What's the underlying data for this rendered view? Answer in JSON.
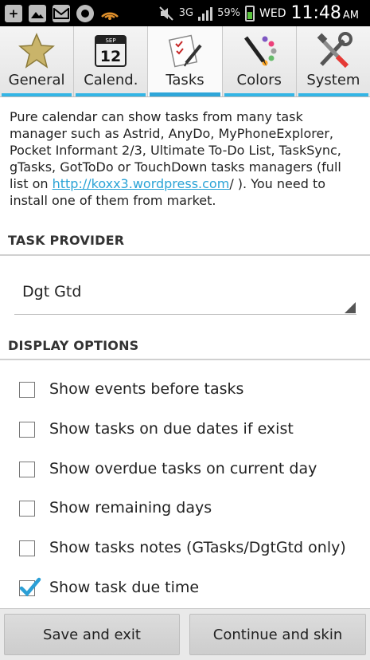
{
  "status_bar": {
    "network": "3G",
    "battery": "59%",
    "day": "WED",
    "time": "11:48",
    "ampm": "AM",
    "left_icons": [
      "plus-icon",
      "image-icon",
      "gmail-icon",
      "app-icon",
      "wifi-icon"
    ]
  },
  "tabs": [
    {
      "label": "General",
      "icon": "star-icon",
      "active": false
    },
    {
      "label": "Calend.",
      "icon": "calendar-icon",
      "active": false
    },
    {
      "label": "Tasks",
      "icon": "tasks-icon",
      "active": true
    },
    {
      "label": "Colors",
      "icon": "palette-icon",
      "active": false
    },
    {
      "label": "System",
      "icon": "tools-icon",
      "active": false
    }
  ],
  "calendar_icon": {
    "month": "SEP",
    "day": "12"
  },
  "intro": {
    "before_link": "Pure calendar can show tasks from many task manager such as Astrid, AnyDo, MyPhoneExplorer, Pocket Informant 2/3, Ultimate To-Do List, TaskSync, gTasks, GotToDo or TouchDown tasks managers (full list on ",
    "link": "http://koxx3.wordpress.com",
    "after_link": "/ ). You need to install one of them from market."
  },
  "task_provider": {
    "header": "TASK PROVIDER",
    "value": "Dgt Gtd"
  },
  "display_options": {
    "header": "DISPLAY OPTIONS",
    "items": [
      {
        "label": "Show events before tasks",
        "checked": false
      },
      {
        "label": "Show tasks on due dates if exist",
        "checked": false
      },
      {
        "label": "Show overdue tasks on current day",
        "checked": false
      },
      {
        "label": "Show remaining days",
        "checked": false
      },
      {
        "label": "Show tasks notes (GTasks/DgtGtd only)",
        "checked": false
      },
      {
        "label": "Show task due time",
        "checked": true
      }
    ]
  },
  "buttons": {
    "save": "Save and exit",
    "continue": "Continue and skin"
  },
  "colors": {
    "accent": "#33b5e5",
    "link": "#2aa3d6",
    "check": "#2b9fd6"
  }
}
